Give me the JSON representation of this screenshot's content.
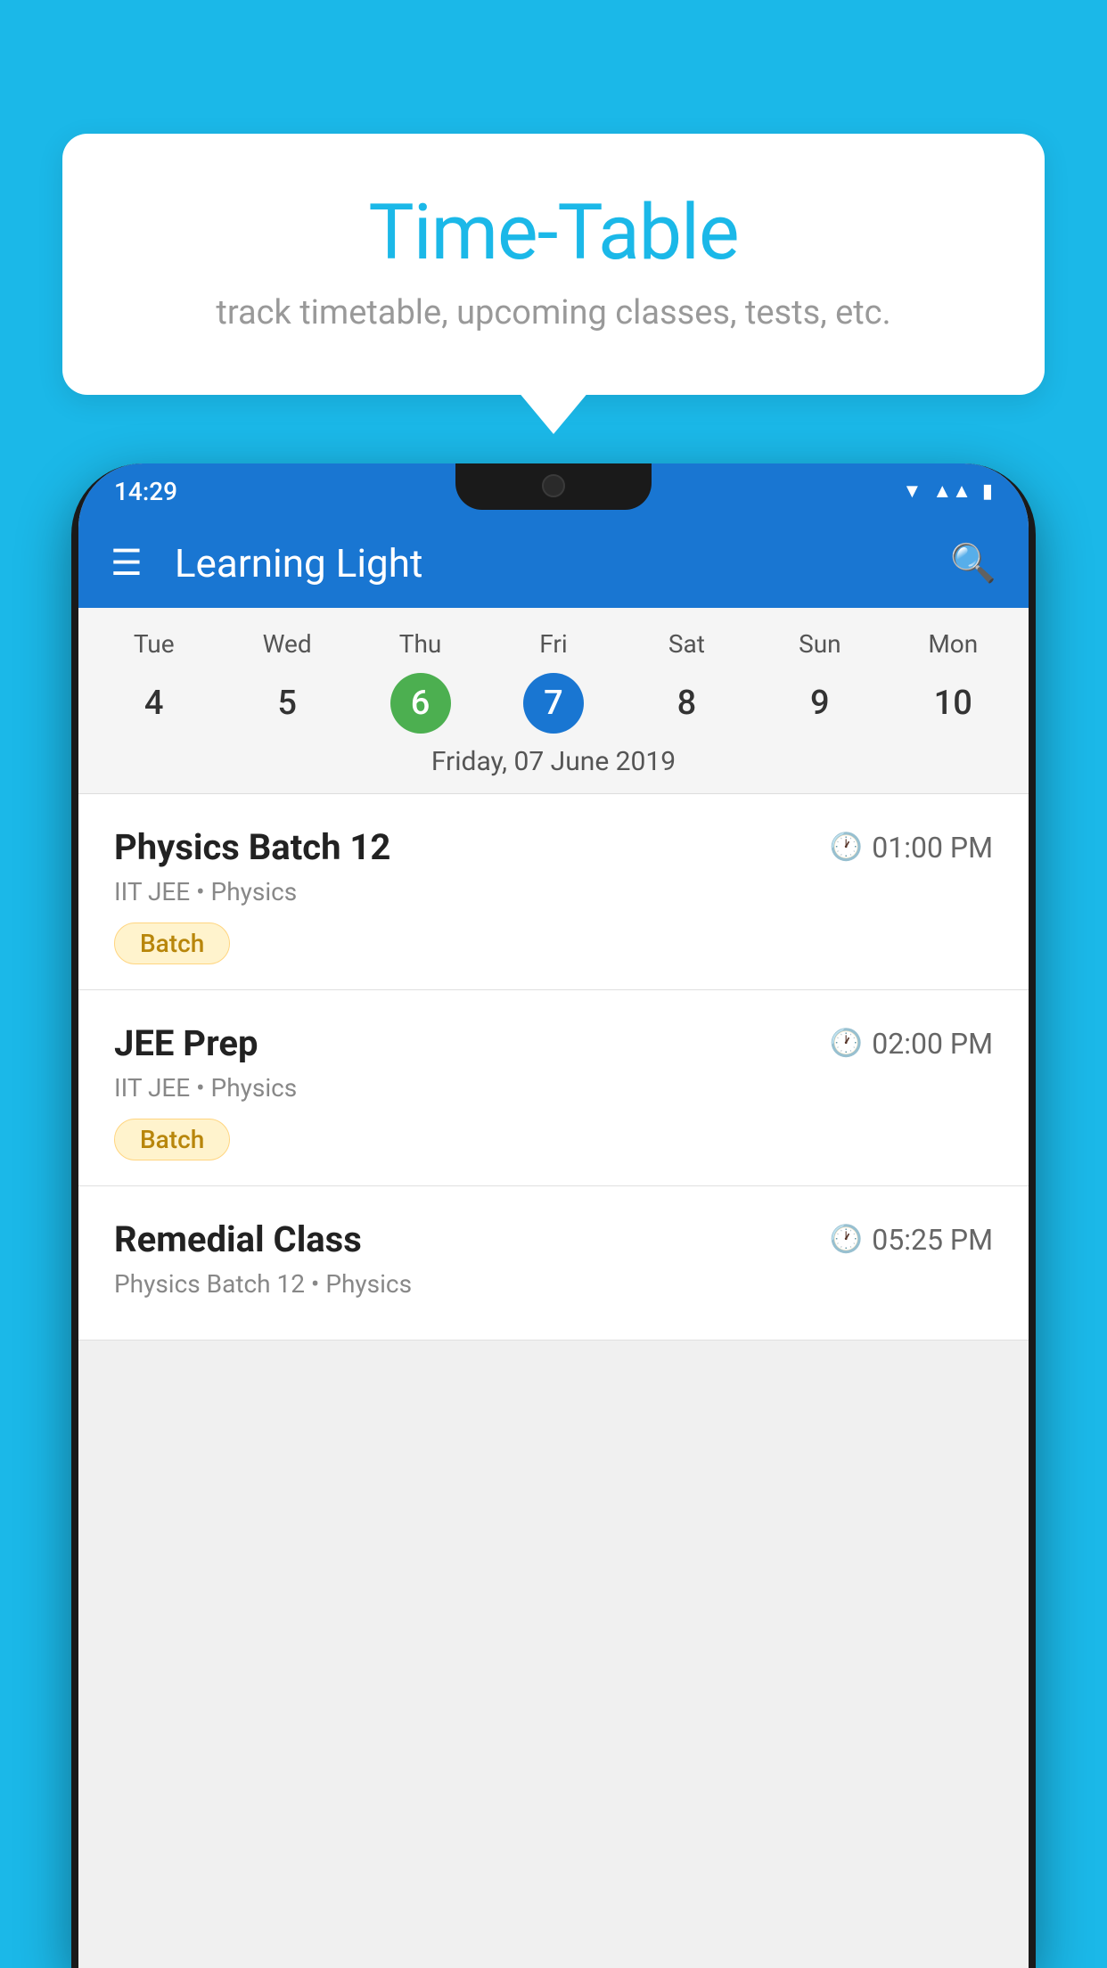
{
  "background_color": "#1BB8E8",
  "card": {
    "title": "Time-Table",
    "subtitle": "track timetable, upcoming classes, tests, etc."
  },
  "phone": {
    "status_bar": {
      "time": "14:29"
    },
    "app_bar": {
      "title": "Learning Light"
    },
    "calendar": {
      "days": [
        "Tue",
        "Wed",
        "Thu",
        "Fri",
        "Sat",
        "Sun",
        "Mon"
      ],
      "numbers": [
        "4",
        "5",
        "6",
        "7",
        "8",
        "9",
        "10"
      ],
      "today_index": 2,
      "selected_index": 3,
      "selected_date_label": "Friday, 07 June 2019"
    },
    "schedule": [
      {
        "title": "Physics Batch 12",
        "time": "01:00 PM",
        "meta": "IIT JEE • Physics",
        "badge": "Batch"
      },
      {
        "title": "JEE Prep",
        "time": "02:00 PM",
        "meta": "IIT JEE • Physics",
        "badge": "Batch"
      },
      {
        "title": "Remedial Class",
        "time": "05:25 PM",
        "meta": "Physics Batch 12 • Physics",
        "badge": null
      }
    ]
  }
}
